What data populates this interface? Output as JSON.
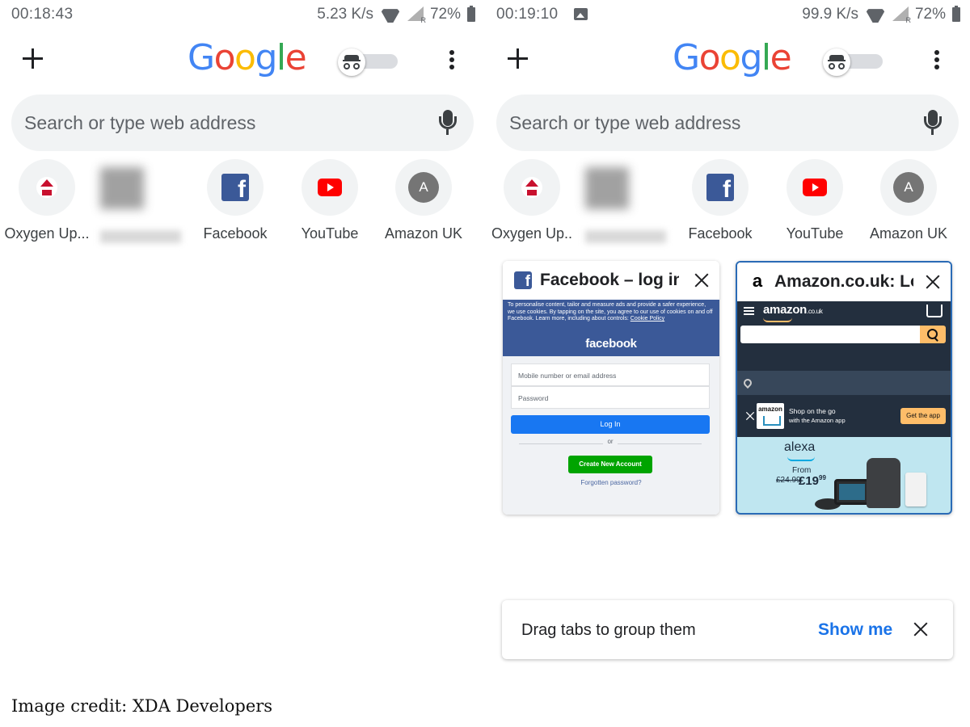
{
  "left": {
    "status": {
      "time": "00:18:43",
      "speed": "5.23 K/s",
      "battery": "72%"
    },
    "toolbar": {
      "logo": "Google",
      "new_tab_icon": "plus-icon",
      "incognito_icon": "incognito-icon",
      "menu_icon": "more-vert-icon"
    },
    "search": {
      "placeholder": "Search or type web address",
      "mic_icon": "mic-icon"
    },
    "tiles": [
      {
        "label": "Oxygen Up...",
        "icon": "oxygen-updater-icon"
      },
      {
        "label": "",
        "icon": "blurred-site-icon"
      },
      {
        "label": "Facebook",
        "icon": "facebook-icon"
      },
      {
        "label": "YouTube",
        "icon": "youtube-icon"
      },
      {
        "label": "Amazon UK",
        "icon": "letter-avatar-icon",
        "letter": "A"
      }
    ]
  },
  "right": {
    "status": {
      "time": "00:19:10",
      "speed": "99.9 K/s",
      "battery": "72%"
    },
    "toolbar": {
      "logo": "Google"
    },
    "search": {
      "placeholder": "Search or type web address"
    },
    "tiles": [
      {
        "label": "Oxygen Up..",
        "icon": "oxygen-updater-icon"
      },
      {
        "label": "",
        "icon": "blurred-site-icon"
      },
      {
        "label": "Facebook",
        "icon": "facebook-icon"
      },
      {
        "label": "YouTube",
        "icon": "youtube-icon"
      },
      {
        "label": "Amazon UK",
        "icon": "letter-avatar-icon",
        "letter": "A"
      }
    ],
    "tab_cards": [
      {
        "title": "Facebook – log in",
        "favicon": "facebook-icon",
        "preview": {
          "cookie_text": "To personalise content, tailor and measure ads and provide a safer experience, we use cookies. By tapping on the site, you agree to our use of cookies on and off Facebook. Learn more, including about controls:",
          "cookie_link": "Cookie Policy",
          "brand": "facebook",
          "field1": "Mobile number or email address",
          "field2": "Password",
          "login": "Log In",
          "or": "or",
          "create": "Create New Account",
          "forgot": "Forgotten password?"
        }
      },
      {
        "title": "Amazon.co.uk: Lo",
        "favicon": "amazon-a-icon",
        "favicon_glyph": "a",
        "selected": true,
        "preview": {
          "logo": "amazon",
          "logo_suffix": ".co.uk",
          "app_icon_text": "amazon",
          "app_line1": "Shop on the go",
          "app_line2": "with the Amazon app",
          "get_app": "Get the app",
          "alexa": "alexa",
          "from": "From",
          "old_price": "£24.99",
          "new_price": "£19",
          "new_price_pence": "99"
        }
      }
    ],
    "banner": {
      "text": "Drag tabs to group them",
      "action": "Show me"
    }
  },
  "credit": "Image credit: XDA Developers",
  "colors": {
    "accent": "#1a73e8",
    "facebook": "#3b5998",
    "amazon_dark": "#232f3e",
    "amazon_orange": "#febd69",
    "selected_border": "#2a6bb6"
  }
}
